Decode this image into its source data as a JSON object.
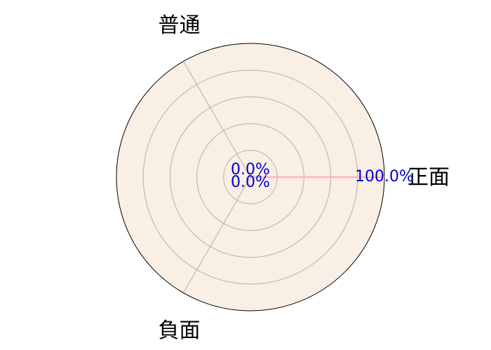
{
  "chart_data": {
    "type": "radar",
    "categories": [
      "正面",
      "普通",
      "負面"
    ],
    "values": [
      100.0,
      0.0,
      0.0
    ],
    "value_labels": [
      "100.0%",
      "0.0%",
      "0.0%"
    ],
    "rlim": [
      0,
      100
    ],
    "grid": true,
    "grid_rings": 5,
    "colors": {
      "background": "#f9efe4",
      "grid": "#b0b0b0",
      "outline": "#000000",
      "series_line": "#ffb6c1",
      "value_label": "#0000cc"
    }
  }
}
